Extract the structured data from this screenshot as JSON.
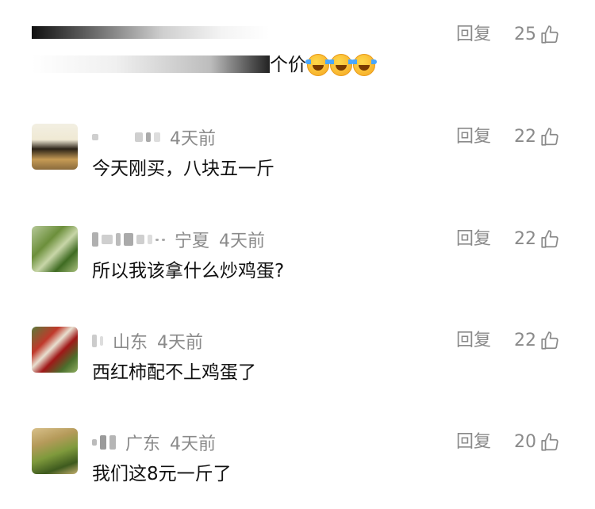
{
  "comments": [
    {
      "text_suffix": "个价",
      "reply": "回复",
      "likes": "25",
      "emoji_count": 3
    },
    {
      "time": "4天前",
      "text": "今天刚买，八块五一斤",
      "reply": "回复",
      "likes": "22"
    },
    {
      "region": "宁夏",
      "time": "4天前",
      "text": "所以我该拿什么炒鸡蛋?",
      "reply": "回复",
      "likes": "22"
    },
    {
      "region": "山东",
      "time": "4天前",
      "text": "西红柿配不上鸡蛋了",
      "reply": "回复",
      "likes": "22"
    },
    {
      "region": "广东",
      "time": "4天前",
      "text": "我们这8元一斤了",
      "reply": "回复",
      "likes": "20"
    }
  ],
  "icons": {
    "like": "thumbs-up-icon",
    "emoji": "laughing-crying-emoji-icon"
  },
  "colors": {
    "meta_gray": "#8a8a8a",
    "text": "#111111"
  }
}
